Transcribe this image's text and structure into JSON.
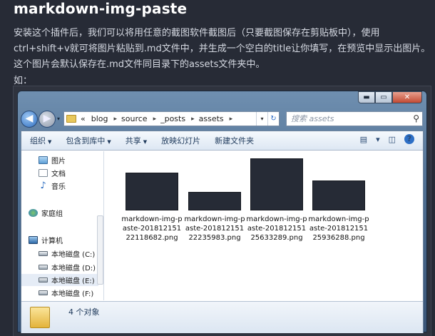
{
  "heading": "markdown-img-paste",
  "paragraph": "安装这个插件后，我们可以将用任意的截图软件截图后（只要截图保存在剪贴板中），使用ctrl+shift+v就可将图片粘贴到.md文件中，并生成一个空白的title让你填写，在预览中显示出图片。这个图片会默认保存在.md文件同目录下的assets文件夹中。",
  "ru": "如：",
  "explorer": {
    "caption": {
      "min": "▬",
      "max": "▭",
      "close": "✕"
    },
    "nav_back": "◀",
    "nav_forward": "▶",
    "nav_drop": "▾",
    "address": {
      "chevrons": "«",
      "crumbs": [
        "blog",
        "source",
        "_posts",
        "assets"
      ],
      "sep": "▸",
      "dropdown": "▾",
      "refresh": "↻"
    },
    "search": {
      "placeholder": "搜索 assets",
      "icon": "⚲"
    },
    "toolbar": {
      "organize": "组织",
      "include": "包含到库中",
      "share": "共享",
      "slideshow": "放映幻灯片",
      "newfolder": "新建文件夹",
      "caret": "▼",
      "view_icon": "▤",
      "view_caret": "▾",
      "pane_icon": "◫",
      "help": "?"
    },
    "nav_items": {
      "pictures": "图片",
      "docs": "文档",
      "music": "音乐",
      "homegroup": "家庭组",
      "computer": "计算机",
      "disk_c": "本地磁盘 (C:)",
      "disk_d": "本地磁盘 (D:)",
      "disk_e": "本地磁盘 (E:)",
      "disk_f": "本地磁盘 (F:)"
    },
    "files": [
      {
        "name": "markdown-img-paste-20181215122118682.png"
      },
      {
        "name": "markdown-img-paste-20181215122235983.png"
      },
      {
        "name": "markdown-img-paste-20181215125633289.png"
      },
      {
        "name": "markdown-img-paste-20181215125936288.png"
      }
    ],
    "status": {
      "count": "4 个对象"
    }
  }
}
